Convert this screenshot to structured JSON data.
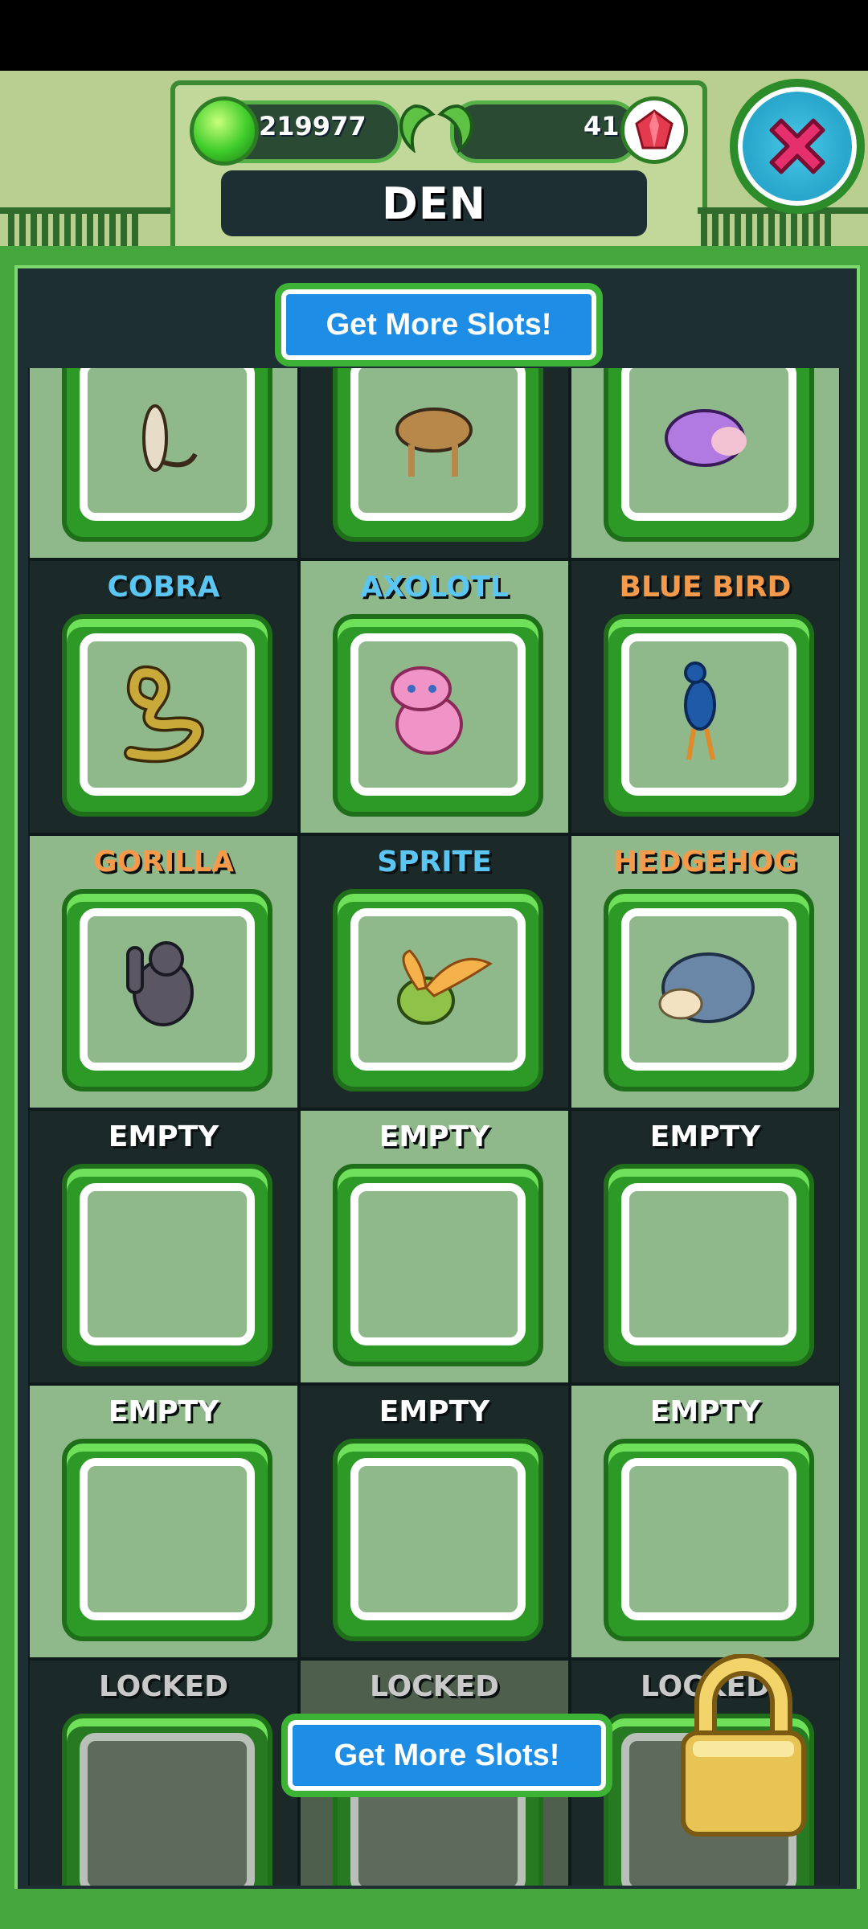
{
  "header": {
    "coins": "219977",
    "gems": "41",
    "title": "DEN"
  },
  "buttons": {
    "more_slots_top": "Get More Slots!",
    "more_slots_bottom": "Get More Slots!"
  },
  "rows": [
    {
      "cells": [
        {
          "label": "",
          "animal": "weasel-icon",
          "state": "filled"
        },
        {
          "label": "",
          "animal": "camel-icon",
          "state": "filled"
        },
        {
          "label": "",
          "animal": "dodo-icon",
          "state": "filled"
        }
      ]
    },
    {
      "cells": [
        {
          "label": "COBRA",
          "color": "#5bc6f3",
          "animal": "cobra-icon",
          "state": "filled"
        },
        {
          "label": "AXOLOTL",
          "color": "#5bc6f3",
          "animal": "axolotl-icon",
          "state": "filled"
        },
        {
          "label": "BLUE BIRD",
          "color": "#f59a4a",
          "animal": "blue-bird-icon",
          "state": "filled"
        }
      ]
    },
    {
      "cells": [
        {
          "label": "GORILLA",
          "color": "#f59a4a",
          "animal": "gorilla-icon",
          "state": "filled"
        },
        {
          "label": "SPRITE",
          "color": "#5bc6f3",
          "animal": "sprite-icon",
          "state": "filled"
        },
        {
          "label": "HEDGEHOG",
          "color": "#f59a4a",
          "animal": "hedgehog-icon",
          "state": "filled"
        }
      ]
    },
    {
      "cells": [
        {
          "label": "EMPTY",
          "state": "empty"
        },
        {
          "label": "EMPTY",
          "state": "empty"
        },
        {
          "label": "EMPTY",
          "state": "empty"
        }
      ]
    },
    {
      "cells": [
        {
          "label": "EMPTY",
          "state": "empty"
        },
        {
          "label": "EMPTY",
          "state": "empty"
        },
        {
          "label": "EMPTY",
          "state": "empty"
        }
      ]
    },
    {
      "cells": [
        {
          "label": "LOCKED",
          "state": "locked"
        },
        {
          "label": "LOCKED",
          "state": "locked"
        },
        {
          "label": "LOCKED",
          "state": "locked"
        }
      ]
    }
  ],
  "colors": {
    "panel_green": "#44a63c",
    "button_blue": "#1e8de6",
    "dark": "#1d2f33"
  }
}
